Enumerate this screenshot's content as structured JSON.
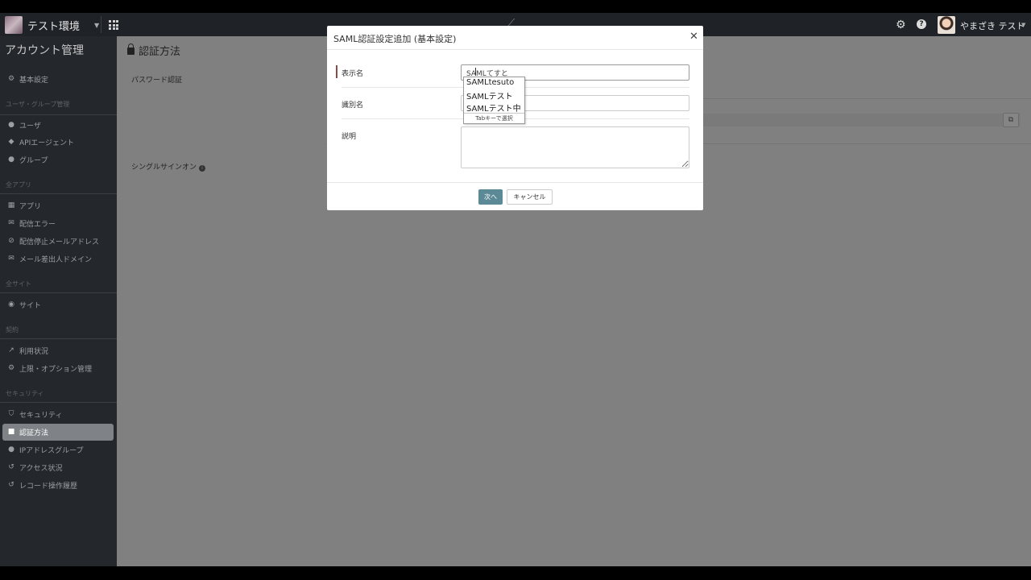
{
  "topnav": {
    "env_name": "テスト環境",
    "user_name": "やまざき テスト"
  },
  "sidebar": {
    "title": "アカウント管理",
    "sections": {
      "users_groups": "ユーザ・グループ管理",
      "all_apps": "全アプリ",
      "all_sites": "全サイト",
      "contract": "契約",
      "security": "セキュリティ"
    },
    "items": {
      "basic": "基本設定",
      "user": "ユーザ",
      "api_agent": "APIエージェント",
      "group": "グループ",
      "app": "アプリ",
      "delivery_error": "配信エラー",
      "blocked_mail": "配信停止メールアドレス",
      "mail_domain": "メール差出人ドメイン",
      "site": "サイト",
      "usage": "利用状況",
      "plan_options": "上限・オプション管理",
      "security": "セキュリティ",
      "auth_method": "認証方法",
      "ip_group": "IPアドレスグループ",
      "access": "アクセス状況",
      "record_history": "レコード操作履歴"
    }
  },
  "main": {
    "title": "認証方法",
    "password_auth": "パスワード認証",
    "sso": "シングルサインオン"
  },
  "modal": {
    "title": "SAML認証設定追加 (基本設定)",
    "display_name_label": "表示名",
    "display_name_value": "SAMLてすと",
    "identifier_label": "識別名",
    "description_label": "説明",
    "next_label": "次へ",
    "cancel_label": "キャンセル"
  },
  "ime": {
    "candidates": [
      "SAMLtesuto",
      "SAMLテスト",
      "SAMLテスト中"
    ],
    "footer": "Tabキーで選択"
  }
}
